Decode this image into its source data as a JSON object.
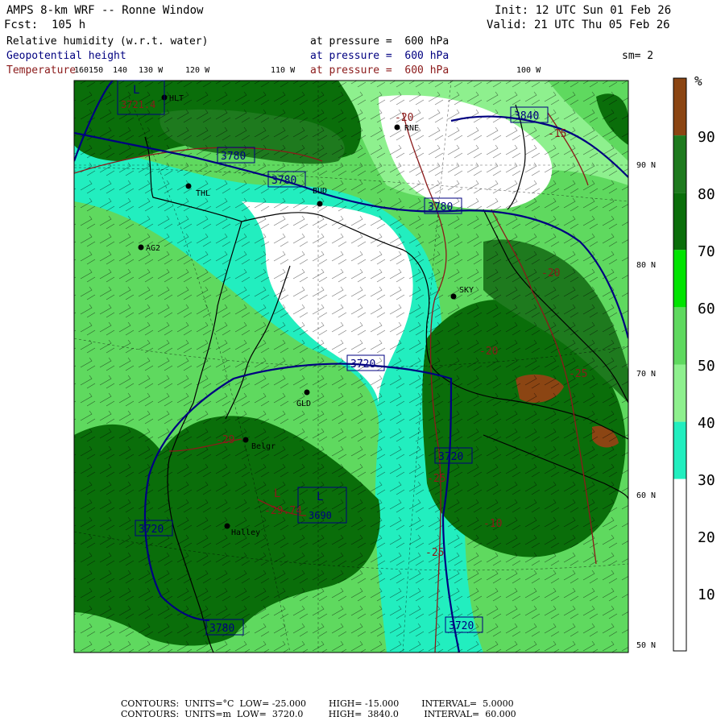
{
  "header": {
    "model": "AMPS 8-km WRF -- Ronne Window",
    "forecast": "Fcst:  105 h",
    "init": "Init: 12 UTC Sun 01 Feb 26",
    "valid": "Valid: 21 UTC Thu 05 Feb 26",
    "field1_name": "Relative humidity (w.r.t. water)",
    "field1_level": "at pressure =  600 hPa",
    "field2_name": "Geopotential height",
    "field2_level": "at pressure =  600 hPa",
    "field3_name": "Temperature",
    "field3_level": "at pressure =  600 hPa",
    "smoothing": "sm= 2"
  },
  "colorbar": {
    "unit": "%",
    "ticks": [
      "90",
      "80",
      "70",
      "60",
      "50",
      "40",
      "30",
      "20",
      "10"
    ],
    "segments": [
      {
        "from": 90,
        "to": 100,
        "color": "#8b4513"
      },
      {
        "from": 80,
        "to": 90,
        "color": "#1e7a1e"
      },
      {
        "from": 70,
        "to": 80,
        "color": "#0a6e0a"
      },
      {
        "from": 60,
        "to": 70,
        "color": "#00e400"
      },
      {
        "from": 50,
        "to": 60,
        "color": "#5fd95f"
      },
      {
        "from": 40,
        "to": 50,
        "color": "#8ef08e"
      },
      {
        "from": 30,
        "to": 40,
        "color": "#22eebf"
      },
      {
        "from": 20,
        "to": 30,
        "color": "#ffffff"
      },
      {
        "from": 0,
        "to": 20,
        "color": "#ffffff"
      }
    ]
  },
  "map": {
    "lon_labels": [
      "160150",
      "140",
      "130 W",
      "120 W",
      "110 W",
      "100 W"
    ],
    "lat_labels": [
      "90 N",
      "80 N",
      "70 N",
      "60 N",
      "50 N"
    ],
    "stations": [
      "HLT",
      "THL",
      "AG2",
      "RNE",
      "BUD",
      "SKY",
      "GLD",
      "Belgr",
      "Halley"
    ],
    "height_labels": [
      "3780",
      "3780",
      "3780",
      "3720",
      "3720",
      "3720",
      "3720",
      "3780",
      "3840",
      "3690"
    ],
    "temp_labels": [
      "-20",
      "-15",
      "-20",
      "-25",
      "-29",
      "-29.74",
      "-25",
      "-25",
      "-20",
      "-10"
    ],
    "low_labels": [
      "L",
      "L",
      "L"
    ],
    "low_values": [
      "3721.4",
      "3690"
    ],
    "legend_colors": {
      "height": "#000080",
      "temperature": "#8b1a1a",
      "coast": "#000000"
    }
  },
  "footer": {
    "line1": {
      "label": "CONTOURS:",
      "units": "UNITS=°C",
      "low": "LOW= -25.000",
      "high": "HIGH= -15.000",
      "interval": "INTERVAL=  5.0000"
    },
    "line2": {
      "label": "CONTOURS:",
      "units": "UNITS=m",
      "low": "LOW=  3720.0",
      "high": "HIGH=  3840.0",
      "interval": "INTERVAL=  60.000"
    }
  }
}
